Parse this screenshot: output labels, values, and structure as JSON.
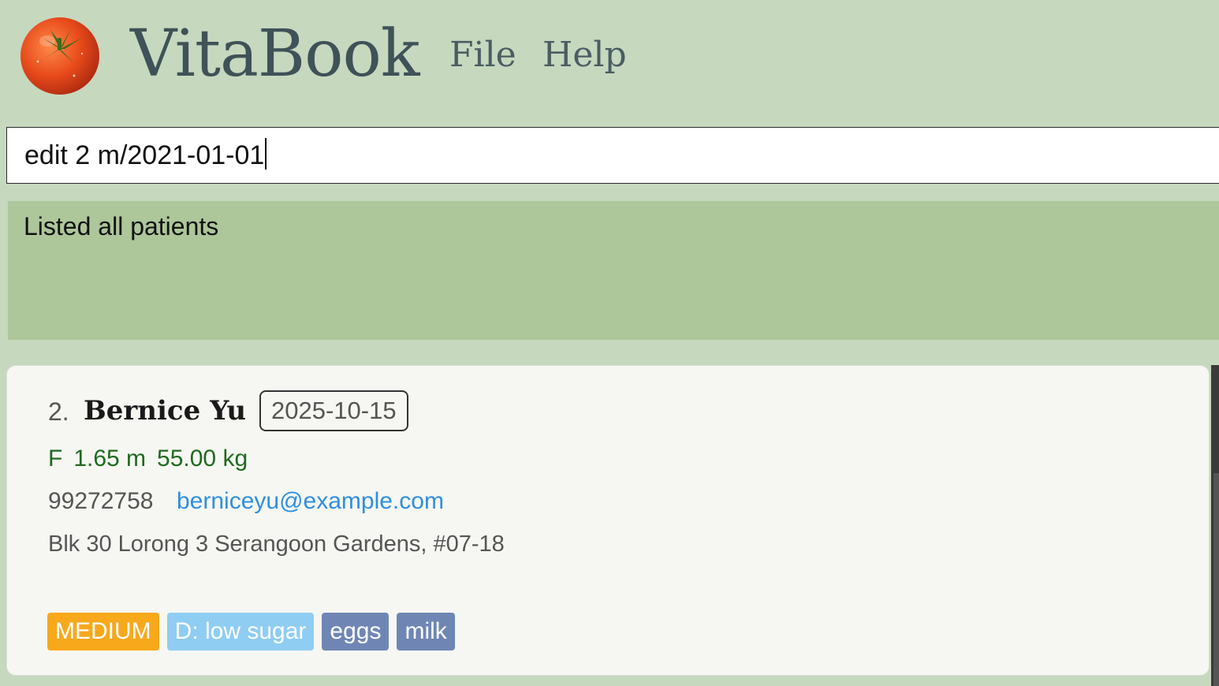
{
  "header": {
    "app_title": "VitaBook",
    "menu": [
      {
        "label": "File"
      },
      {
        "label": "Help"
      }
    ]
  },
  "command": {
    "value": "edit 2 m/2021-01-01"
  },
  "result": {
    "message": "Listed all patients"
  },
  "patients": [
    {
      "index": "2.",
      "name": "Bernice Yu",
      "date": "2025-10-15",
      "sex": "F",
      "height": "1.65 m",
      "weight": "55.00 kg",
      "phone": "99272758",
      "email": "berniceyu@example.com",
      "address": "Blk 30 Lorong 3 Serangoon Gardens, #07-18",
      "priority_tag": "MEDIUM",
      "diet_tag": "D: low sugar",
      "allergy_tags": [
        "eggs",
        "milk"
      ]
    }
  ],
  "colors": {
    "background": "#c6d8be",
    "result_panel": "#adc69a",
    "card": "#f6f7f2",
    "priority_medium": "#f7a81b",
    "diet_tag": "#8fcdf2",
    "allergy_tag": "#6f86b5",
    "vitals_text": "#1f6a1f",
    "email_text": "#2e8fe0"
  },
  "icons": {
    "logo": "tomato-logo-icon"
  }
}
